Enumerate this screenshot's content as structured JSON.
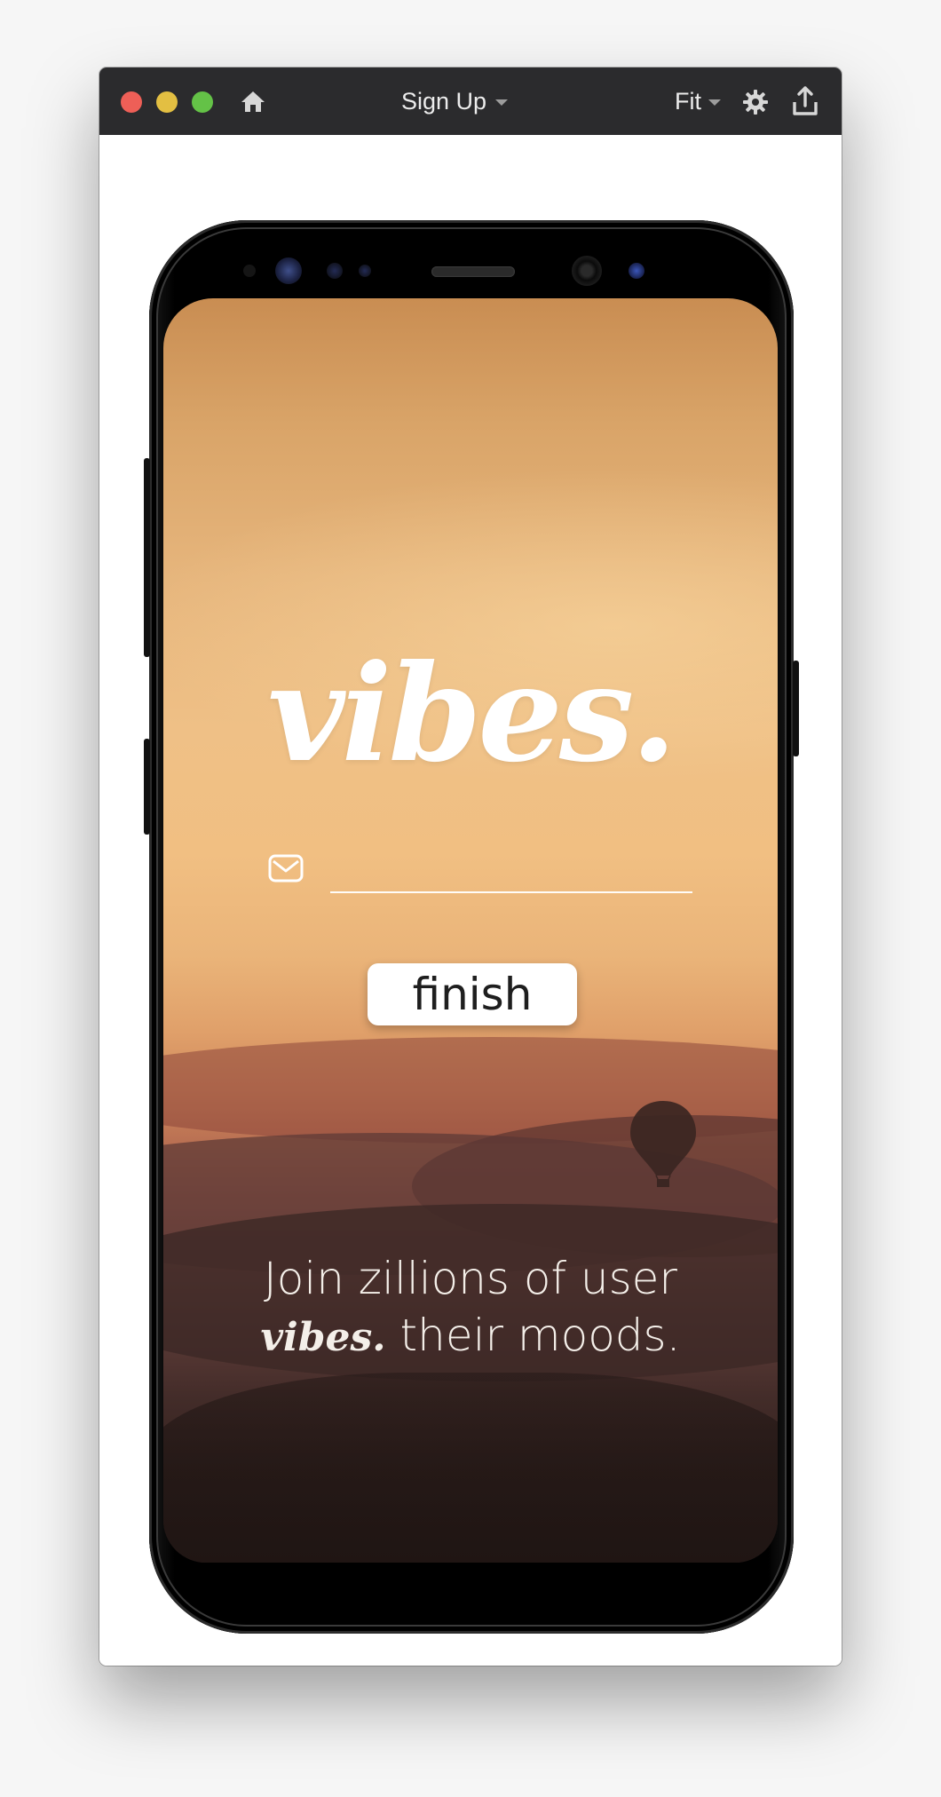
{
  "window": {
    "title": "Sign Up",
    "zoom": "Fit",
    "icons": [
      "home-icon",
      "gear-icon",
      "share-icon"
    ]
  },
  "app": {
    "logo": "vibes.",
    "email_field": {
      "value": "",
      "placeholder": ""
    },
    "finish_label": "finish",
    "tagline": {
      "line1": "Join zillions of user",
      "line2_brand": "vibes.",
      "line2_rest": " their moods."
    }
  },
  "colors": {
    "titlebar": "#2b2b2d",
    "close": "#ee5f57",
    "minimize": "#e3bf42",
    "maximize": "#64c247",
    "sky_top": "#c98d52",
    "sky_mid": "#f1bf82",
    "ground": "#2b1d1b"
  }
}
